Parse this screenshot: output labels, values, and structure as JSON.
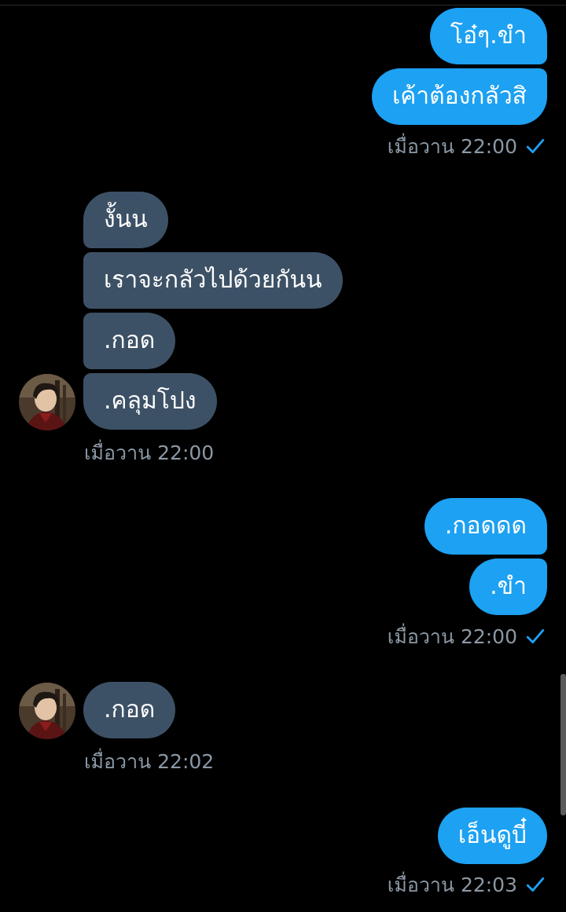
{
  "messages": {
    "out1": "โอ๋ๆ.ขำ",
    "out2": "เค้าต้องกลัวสิ",
    "out1_time": "เมื่อวาน 22:00",
    "in1": "งั้นน",
    "in2": "เราจะกลัวไปด้วยกันน",
    "in3": ".กอด",
    "in4": ".คลุมโปง",
    "in1_time": "เมื่อวาน 22:00",
    "out3": ".กอดดด",
    "out4": ".ขำ",
    "out2_time": "เมื่อวาน 22:00",
    "in5": ".กอด",
    "in2_time": "เมื่อวาน 22:02",
    "out5": "เอ็นดูบี๋",
    "out3_time": "เมื่อวาน 22:03"
  },
  "colors": {
    "outgoing_bubble": "#1da1f2",
    "incoming_bubble": "#3d5166",
    "timestamp": "#8b98a5",
    "read_check": "#1da1f2",
    "background": "#000000"
  },
  "icons": {
    "read_receipt": "check-icon",
    "contact_avatar": "avatar"
  }
}
